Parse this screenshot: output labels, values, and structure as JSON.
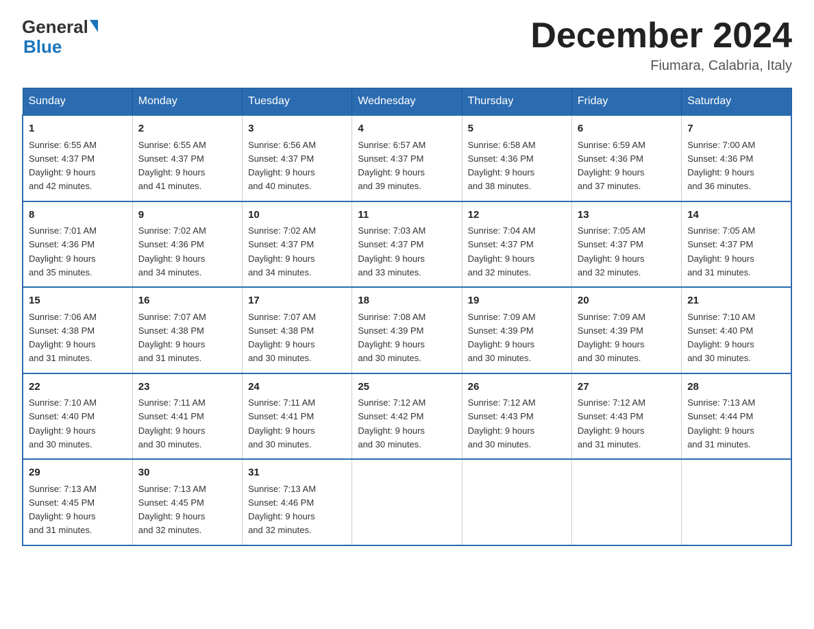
{
  "header": {
    "logo_general": "General",
    "logo_blue": "Blue",
    "title": "December 2024",
    "location": "Fiumara, Calabria, Italy"
  },
  "days_of_week": [
    "Sunday",
    "Monday",
    "Tuesday",
    "Wednesday",
    "Thursday",
    "Friday",
    "Saturday"
  ],
  "weeks": [
    [
      {
        "day": "1",
        "sunrise": "6:55 AM",
        "sunset": "4:37 PM",
        "daylight": "9 hours and 42 minutes."
      },
      {
        "day": "2",
        "sunrise": "6:55 AM",
        "sunset": "4:37 PM",
        "daylight": "9 hours and 41 minutes."
      },
      {
        "day": "3",
        "sunrise": "6:56 AM",
        "sunset": "4:37 PM",
        "daylight": "9 hours and 40 minutes."
      },
      {
        "day": "4",
        "sunrise": "6:57 AM",
        "sunset": "4:37 PM",
        "daylight": "9 hours and 39 minutes."
      },
      {
        "day": "5",
        "sunrise": "6:58 AM",
        "sunset": "4:36 PM",
        "daylight": "9 hours and 38 minutes."
      },
      {
        "day": "6",
        "sunrise": "6:59 AM",
        "sunset": "4:36 PM",
        "daylight": "9 hours and 37 minutes."
      },
      {
        "day": "7",
        "sunrise": "7:00 AM",
        "sunset": "4:36 PM",
        "daylight": "9 hours and 36 minutes."
      }
    ],
    [
      {
        "day": "8",
        "sunrise": "7:01 AM",
        "sunset": "4:36 PM",
        "daylight": "9 hours and 35 minutes."
      },
      {
        "day": "9",
        "sunrise": "7:02 AM",
        "sunset": "4:36 PM",
        "daylight": "9 hours and 34 minutes."
      },
      {
        "day": "10",
        "sunrise": "7:02 AM",
        "sunset": "4:37 PM",
        "daylight": "9 hours and 34 minutes."
      },
      {
        "day": "11",
        "sunrise": "7:03 AM",
        "sunset": "4:37 PM",
        "daylight": "9 hours and 33 minutes."
      },
      {
        "day": "12",
        "sunrise": "7:04 AM",
        "sunset": "4:37 PM",
        "daylight": "9 hours and 32 minutes."
      },
      {
        "day": "13",
        "sunrise": "7:05 AM",
        "sunset": "4:37 PM",
        "daylight": "9 hours and 32 minutes."
      },
      {
        "day": "14",
        "sunrise": "7:05 AM",
        "sunset": "4:37 PM",
        "daylight": "9 hours and 31 minutes."
      }
    ],
    [
      {
        "day": "15",
        "sunrise": "7:06 AM",
        "sunset": "4:38 PM",
        "daylight": "9 hours and 31 minutes."
      },
      {
        "day": "16",
        "sunrise": "7:07 AM",
        "sunset": "4:38 PM",
        "daylight": "9 hours and 31 minutes."
      },
      {
        "day": "17",
        "sunrise": "7:07 AM",
        "sunset": "4:38 PM",
        "daylight": "9 hours and 30 minutes."
      },
      {
        "day": "18",
        "sunrise": "7:08 AM",
        "sunset": "4:39 PM",
        "daylight": "9 hours and 30 minutes."
      },
      {
        "day": "19",
        "sunrise": "7:09 AM",
        "sunset": "4:39 PM",
        "daylight": "9 hours and 30 minutes."
      },
      {
        "day": "20",
        "sunrise": "7:09 AM",
        "sunset": "4:39 PM",
        "daylight": "9 hours and 30 minutes."
      },
      {
        "day": "21",
        "sunrise": "7:10 AM",
        "sunset": "4:40 PM",
        "daylight": "9 hours and 30 minutes."
      }
    ],
    [
      {
        "day": "22",
        "sunrise": "7:10 AM",
        "sunset": "4:40 PM",
        "daylight": "9 hours and 30 minutes."
      },
      {
        "day": "23",
        "sunrise": "7:11 AM",
        "sunset": "4:41 PM",
        "daylight": "9 hours and 30 minutes."
      },
      {
        "day": "24",
        "sunrise": "7:11 AM",
        "sunset": "4:41 PM",
        "daylight": "9 hours and 30 minutes."
      },
      {
        "day": "25",
        "sunrise": "7:12 AM",
        "sunset": "4:42 PM",
        "daylight": "9 hours and 30 minutes."
      },
      {
        "day": "26",
        "sunrise": "7:12 AM",
        "sunset": "4:43 PM",
        "daylight": "9 hours and 30 minutes."
      },
      {
        "day": "27",
        "sunrise": "7:12 AM",
        "sunset": "4:43 PM",
        "daylight": "9 hours and 31 minutes."
      },
      {
        "day": "28",
        "sunrise": "7:13 AM",
        "sunset": "4:44 PM",
        "daylight": "9 hours and 31 minutes."
      }
    ],
    [
      {
        "day": "29",
        "sunrise": "7:13 AM",
        "sunset": "4:45 PM",
        "daylight": "9 hours and 31 minutes."
      },
      {
        "day": "30",
        "sunrise": "7:13 AM",
        "sunset": "4:45 PM",
        "daylight": "9 hours and 32 minutes."
      },
      {
        "day": "31",
        "sunrise": "7:13 AM",
        "sunset": "4:46 PM",
        "daylight": "9 hours and 32 minutes."
      },
      null,
      null,
      null,
      null
    ]
  ],
  "labels": {
    "sunrise": "Sunrise:",
    "sunset": "Sunset:",
    "daylight": "Daylight:"
  }
}
